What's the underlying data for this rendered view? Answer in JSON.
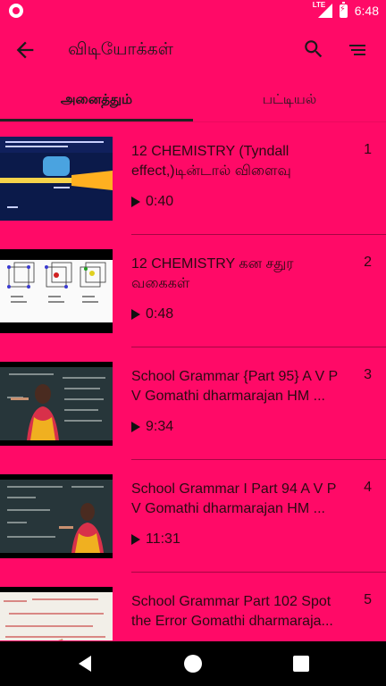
{
  "status_bar": {
    "network": "LTE",
    "time": "6:48"
  },
  "app_bar": {
    "title": "விடியோக்கள்",
    "back_icon": "arrow-back-icon",
    "search_icon": "search-icon",
    "sort_icon": "sort-icon"
  },
  "tabs": [
    {
      "label": "அனைத்தும்",
      "active": true
    },
    {
      "label": "பட்டியல்",
      "active": false
    }
  ],
  "videos": [
    {
      "title": "12 CHEMISTRY (Tyndall effect,)டின்டால் விளைவு",
      "duration": "0:40",
      "index": "1"
    },
    {
      "title": "12 CHEMISTRY   கன சதுர வகைகள்",
      "duration": "0:48",
      "index": "2"
    },
    {
      "title": "School Grammar {Part 95} A V P V Gomathi dharmarajan HM ...",
      "duration": "9:34",
      "index": "3"
    },
    {
      "title": "School Grammar I Part 94 A V P V Gomathi dharmarajan HM ...",
      "duration": "11:31",
      "index": "4"
    },
    {
      "title": "School Grammar Part 102 Spot the Error Gomathi dharmaraja...",
      "duration": "",
      "index": "5"
    }
  ],
  "colors": {
    "background": "#ff0a67",
    "nav_bar": "#000000"
  }
}
